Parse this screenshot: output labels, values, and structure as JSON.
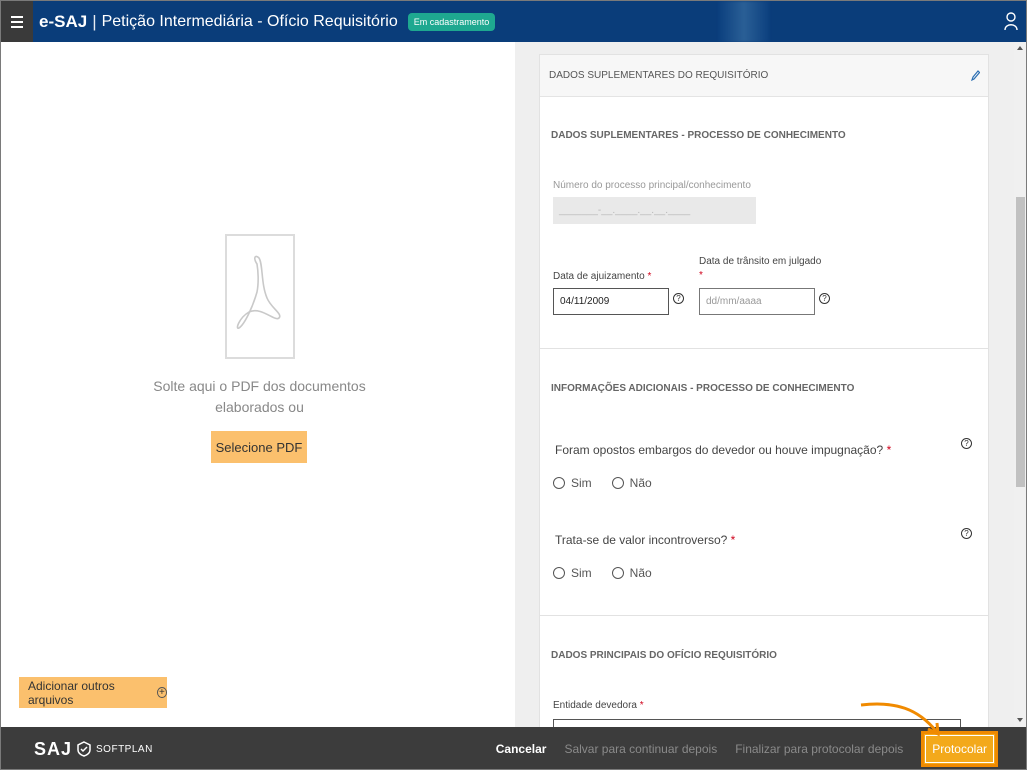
{
  "topbar": {
    "brand": "e-SAJ",
    "separator": "|",
    "title": "Petição Intermediária - Ofício Requisitório",
    "status_badge": "Em cadastramento"
  },
  "upload": {
    "drop_text": "Solte aqui o PDF dos documentos elaborados ou",
    "select_pdf_label": "Selecione PDF",
    "add_files_label": "Adicionar outros arquivos"
  },
  "form": {
    "card_title": "DADOS SUPLEMENTARES DO REQUISITÓRIO",
    "section1_title": "DADOS SUPLEMENTARES - PROCESSO DE CONHECIMENTO",
    "processo_label": "Número do processo principal/conhecimento",
    "processo_placeholder": "_______-__.____.__.__.____",
    "ajuizamento_label": "Data de ajuizamento",
    "ajuizamento_value": "04/11/2009",
    "transito_label": "Data de trânsito em julgado",
    "transito_placeholder": "dd/mm/aaaa",
    "required_mark": "*",
    "section2_title": "INFORMAÇÕES ADICIONAIS - PROCESSO DE CONHECIMENTO",
    "q1": "Foram opostos embargos do devedor ou houve impugnação?",
    "q2": "Trata-se de valor incontroverso?",
    "yes_label": "Sim",
    "no_label": "Não",
    "section3_title": "DADOS PRINCIPAIS DO OFÍCIO REQUISITÓRIO",
    "entidade_label": "Entidade devedora",
    "help_glyph": "?"
  },
  "footer": {
    "logo_saj": "SAJ",
    "logo_softplan": "SOFTPLAN",
    "cancel_label": "Cancelar",
    "save_label": "Salvar para continuar depois",
    "finalize_label": "Finalizar para protocolar depois",
    "protocol_label": "Protocolar"
  },
  "colors": {
    "topbar": "#0a3d7a",
    "badge": "#1ea890",
    "accent_button": "#fbc06d",
    "protocol_button": "#f3a91b",
    "footer": "#3c3c3c"
  }
}
